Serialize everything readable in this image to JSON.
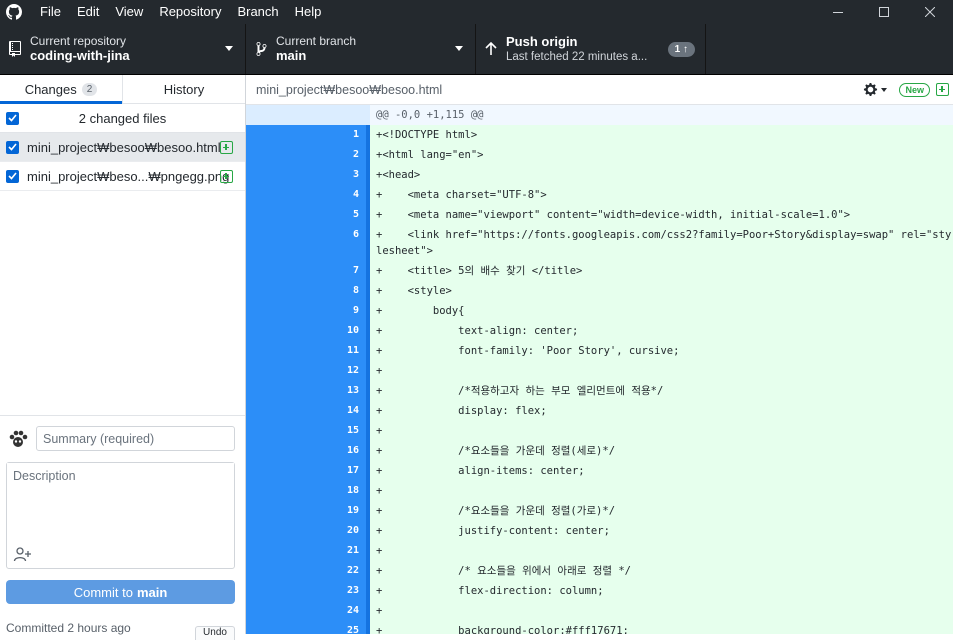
{
  "menu": [
    "File",
    "Edit",
    "View",
    "Repository",
    "Branch",
    "Help"
  ],
  "toolbar": {
    "repo_label": "Current repository",
    "repo_value": "coding-with-jina",
    "branch_label": "Current branch",
    "branch_value": "main",
    "push_label": "Push origin",
    "push_sub": "Last fetched 22 minutes a...",
    "push_count": "1 ↑"
  },
  "sidebar": {
    "tab_changes": "Changes",
    "tab_changes_count": "2",
    "tab_history": "History",
    "files_header": "2 changed files",
    "files": [
      {
        "name": "mini_project₩besoo₩besoo.html"
      },
      {
        "name": "mini_project₩beso...₩pngegg.png"
      }
    ],
    "summary_placeholder": "Summary (required)",
    "description_placeholder": "Description",
    "commit_prefix": "Commit to",
    "commit_branch": "main",
    "committed_text": "Committed 2 hours ago",
    "undo_label": "Undo"
  },
  "diff": {
    "path": "mini_project₩besoo₩besoo.html",
    "new_badge": "New",
    "hunk_header": "@@ -0,0 +1,115 @@",
    "lines": [
      {
        "n": "1",
        "text": "+<!DOCTYPE html>"
      },
      {
        "n": "2",
        "text": "+<html lang=\"en\">"
      },
      {
        "n": "3",
        "text": "+<head>"
      },
      {
        "n": "4",
        "text": "+    <meta charset=\"UTF-8\">"
      },
      {
        "n": "5",
        "text": "+    <meta name=\"viewport\" content=\"width=device-width, initial-scale=1.0\">"
      },
      {
        "n": "6",
        "text": "+    <link href=\"https://fonts.googleapis.com/css2?family=Poor+Story&display=swap\" rel=\"stylesheet\">"
      },
      {
        "n": "7",
        "text": "+    <title> 5의 배수 찾기 </title>"
      },
      {
        "n": "8",
        "text": "+    <style>"
      },
      {
        "n": "9",
        "text": "+        body{"
      },
      {
        "n": "10",
        "text": "+            text-align: center;"
      },
      {
        "n": "11",
        "text": "+            font-family: 'Poor Story', cursive;"
      },
      {
        "n": "12",
        "text": "+"
      },
      {
        "n": "13",
        "text": "+            /*적용하고자 하는 부모 엘리먼트에 적용*/"
      },
      {
        "n": "14",
        "text": "+            display: flex;"
      },
      {
        "n": "15",
        "text": "+"
      },
      {
        "n": "16",
        "text": "+            /*요소들을 가운데 정렬(세로)*/"
      },
      {
        "n": "17",
        "text": "+            align-items: center;"
      },
      {
        "n": "18",
        "text": "+"
      },
      {
        "n": "19",
        "text": "+            /*요소들을 가운데 정렬(가로)*/"
      },
      {
        "n": "20",
        "text": "+            justify-content: center;"
      },
      {
        "n": "21",
        "text": "+"
      },
      {
        "n": "22",
        "text": "+            /* 요소들을 위에서 아래로 정렬 */"
      },
      {
        "n": "23",
        "text": "+            flex-direction: column;"
      },
      {
        "n": "24",
        "text": "+"
      },
      {
        "n": "25",
        "text": "+            background-color:#fff17671;"
      }
    ]
  }
}
